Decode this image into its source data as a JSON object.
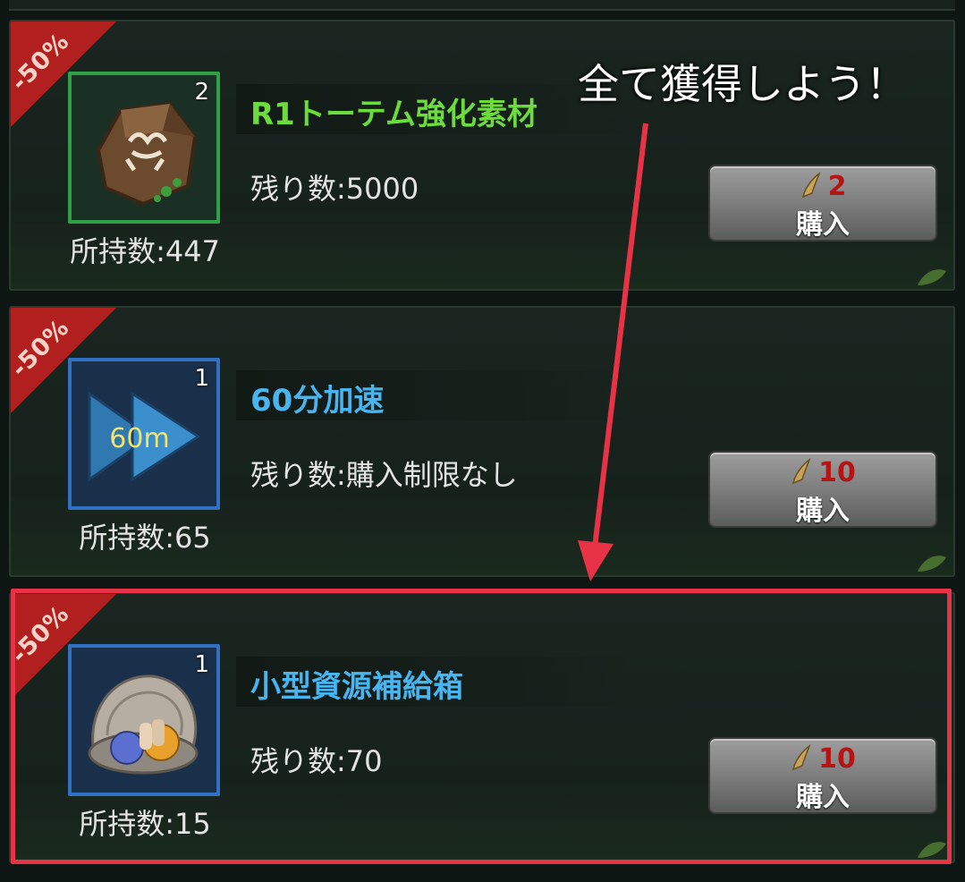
{
  "annotation": {
    "text": "全て獲得しよう！",
    "color": "#e83346"
  },
  "currency_icon": "horn-currency-icon",
  "items": [
    {
      "discount": "-50%",
      "quantity": "2",
      "name": "R1トーテム強化素材",
      "name_color": "#6bdc3b",
      "frame": "green",
      "icon": "totem-stone-icon",
      "owned": "所持数:447",
      "remaining": "残り数:5000",
      "price": "2",
      "buy_label": "購入"
    },
    {
      "discount": "-50%",
      "quantity": "1",
      "name": "60分加速",
      "name_color": "#47b5f0",
      "frame": "blue",
      "icon": "speedup-arrow-icon",
      "icon_text": "60m",
      "owned": "所持数:65",
      "remaining": "残り数:購入制限なし",
      "price": "10",
      "buy_label": "購入"
    },
    {
      "discount": "-50%",
      "quantity": "1",
      "name": "小型資源補給箱",
      "name_color": "#47b5f0",
      "frame": "blue",
      "icon": "resource-shell-icon",
      "owned": "所持数:15",
      "remaining": "残り数:70",
      "price": "10",
      "buy_label": "購入"
    }
  ]
}
